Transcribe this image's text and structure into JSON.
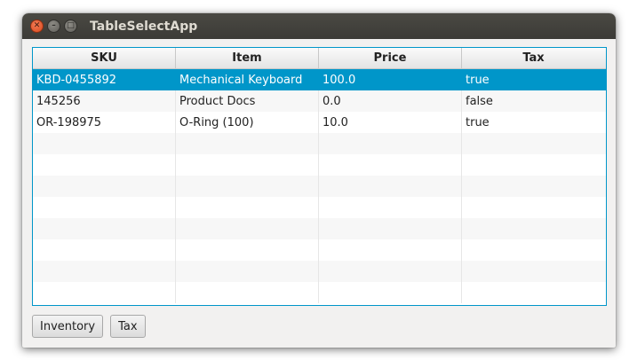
{
  "window": {
    "title": "TableSelectApp"
  },
  "table": {
    "columns": [
      "SKU",
      "Item",
      "Price",
      "Tax"
    ],
    "rows": [
      [
        "KBD-0455892",
        "Mechanical Keyboard",
        "100.0",
        "true"
      ],
      [
        "145256",
        "Product Docs",
        "0.0",
        "false"
      ],
      [
        "OR-198975",
        "O-Ring (100)",
        "10.0",
        "true"
      ]
    ],
    "selected_row": 0
  },
  "buttons": {
    "inventory": "Inventory",
    "tax": "Tax"
  },
  "colors": {
    "selection": "#0096c9",
    "titlebar": "#3c3b37"
  }
}
